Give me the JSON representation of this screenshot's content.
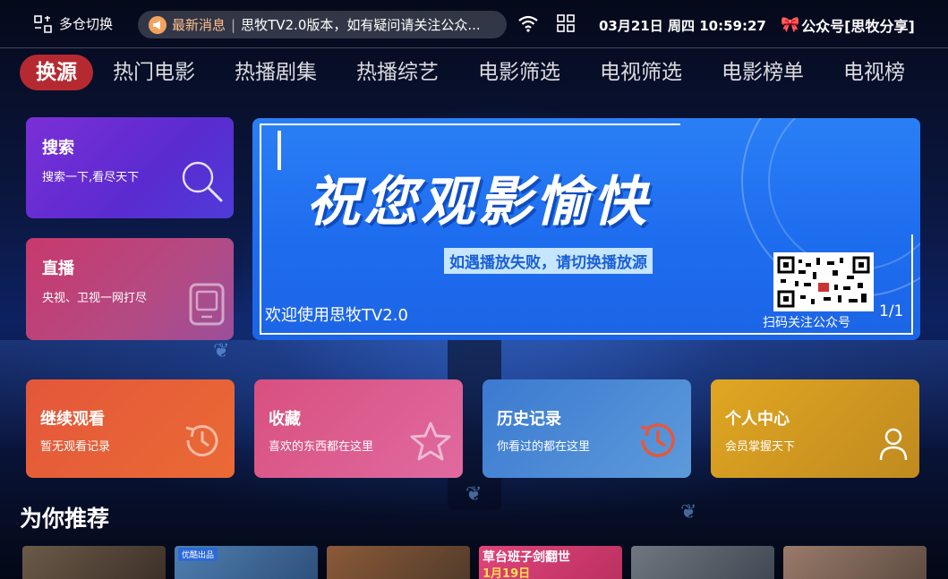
{
  "status_bar": {
    "warehouse_switch_label": "多仓切换",
    "news_tag": "最新消息",
    "news_text": "思牧TV2.0版本，如有疑问请关注公众...",
    "clock": "03月21日 周四 10:59:27",
    "brand": "公众号[思牧分享]"
  },
  "tabs": [
    {
      "label": "换源",
      "active": true
    },
    {
      "label": "热门电影",
      "active": false
    },
    {
      "label": "热播剧集",
      "active": false
    },
    {
      "label": "热播综艺",
      "active": false
    },
    {
      "label": "电影筛选",
      "active": false
    },
    {
      "label": "电视筛选",
      "active": false
    },
    {
      "label": "电影榜单",
      "active": false
    },
    {
      "label": "电视榜",
      "active": false
    }
  ],
  "side_cards": {
    "search": {
      "title": "搜索",
      "subtitle": "搜索一下,看尽天下",
      "icon": "search-icon"
    },
    "live": {
      "title": "直播",
      "subtitle": "央视、卫视一网打尽",
      "icon": "tv-icon"
    }
  },
  "banner": {
    "headline": "祝您观影愉快",
    "notice": "如遇播放失败，请切换播放源",
    "qr_caption": "扫码关注公众号",
    "welcome": "欢迎使用思牧TV2.0",
    "pager": "1/1"
  },
  "feature_cards": {
    "continue": {
      "title": "继续观看",
      "subtitle": "暂无观看记录",
      "icon": "clock-icon"
    },
    "favorites": {
      "title": "收藏",
      "subtitle": "喜欢的东西都在这里",
      "icon": "star-icon"
    },
    "history": {
      "title": "历史记录",
      "subtitle": "你看过的都在这里",
      "icon": "history-icon"
    },
    "user": {
      "title": "个人中心",
      "subtitle": "会员掌握天下",
      "icon": "user-icon"
    }
  },
  "recommend": {
    "section_title": "为你推荐",
    "posters": [
      {
        "tag": "",
        "text": "",
        "text2": "",
        "color": "#5a4a3a"
      },
      {
        "tag": "优酷出品",
        "text": "",
        "text2": "",
        "color": "#3a5f8a"
      },
      {
        "tag": "",
        "text": "",
        "text2": "",
        "color": "#7a4a32"
      },
      {
        "tag": "",
        "text": "草台班子剑翻世",
        "text2": "1月19日",
        "color": "#d83a6a"
      },
      {
        "tag": "",
        "text": "",
        "text2": "",
        "color": "#5d6670"
      },
      {
        "tag": "",
        "text": "",
        "text2": "",
        "color": "#8a6a5a"
      }
    ]
  },
  "colors": {
    "active_tab": "#b52a30",
    "banner_blue": "#1f6ef0"
  }
}
